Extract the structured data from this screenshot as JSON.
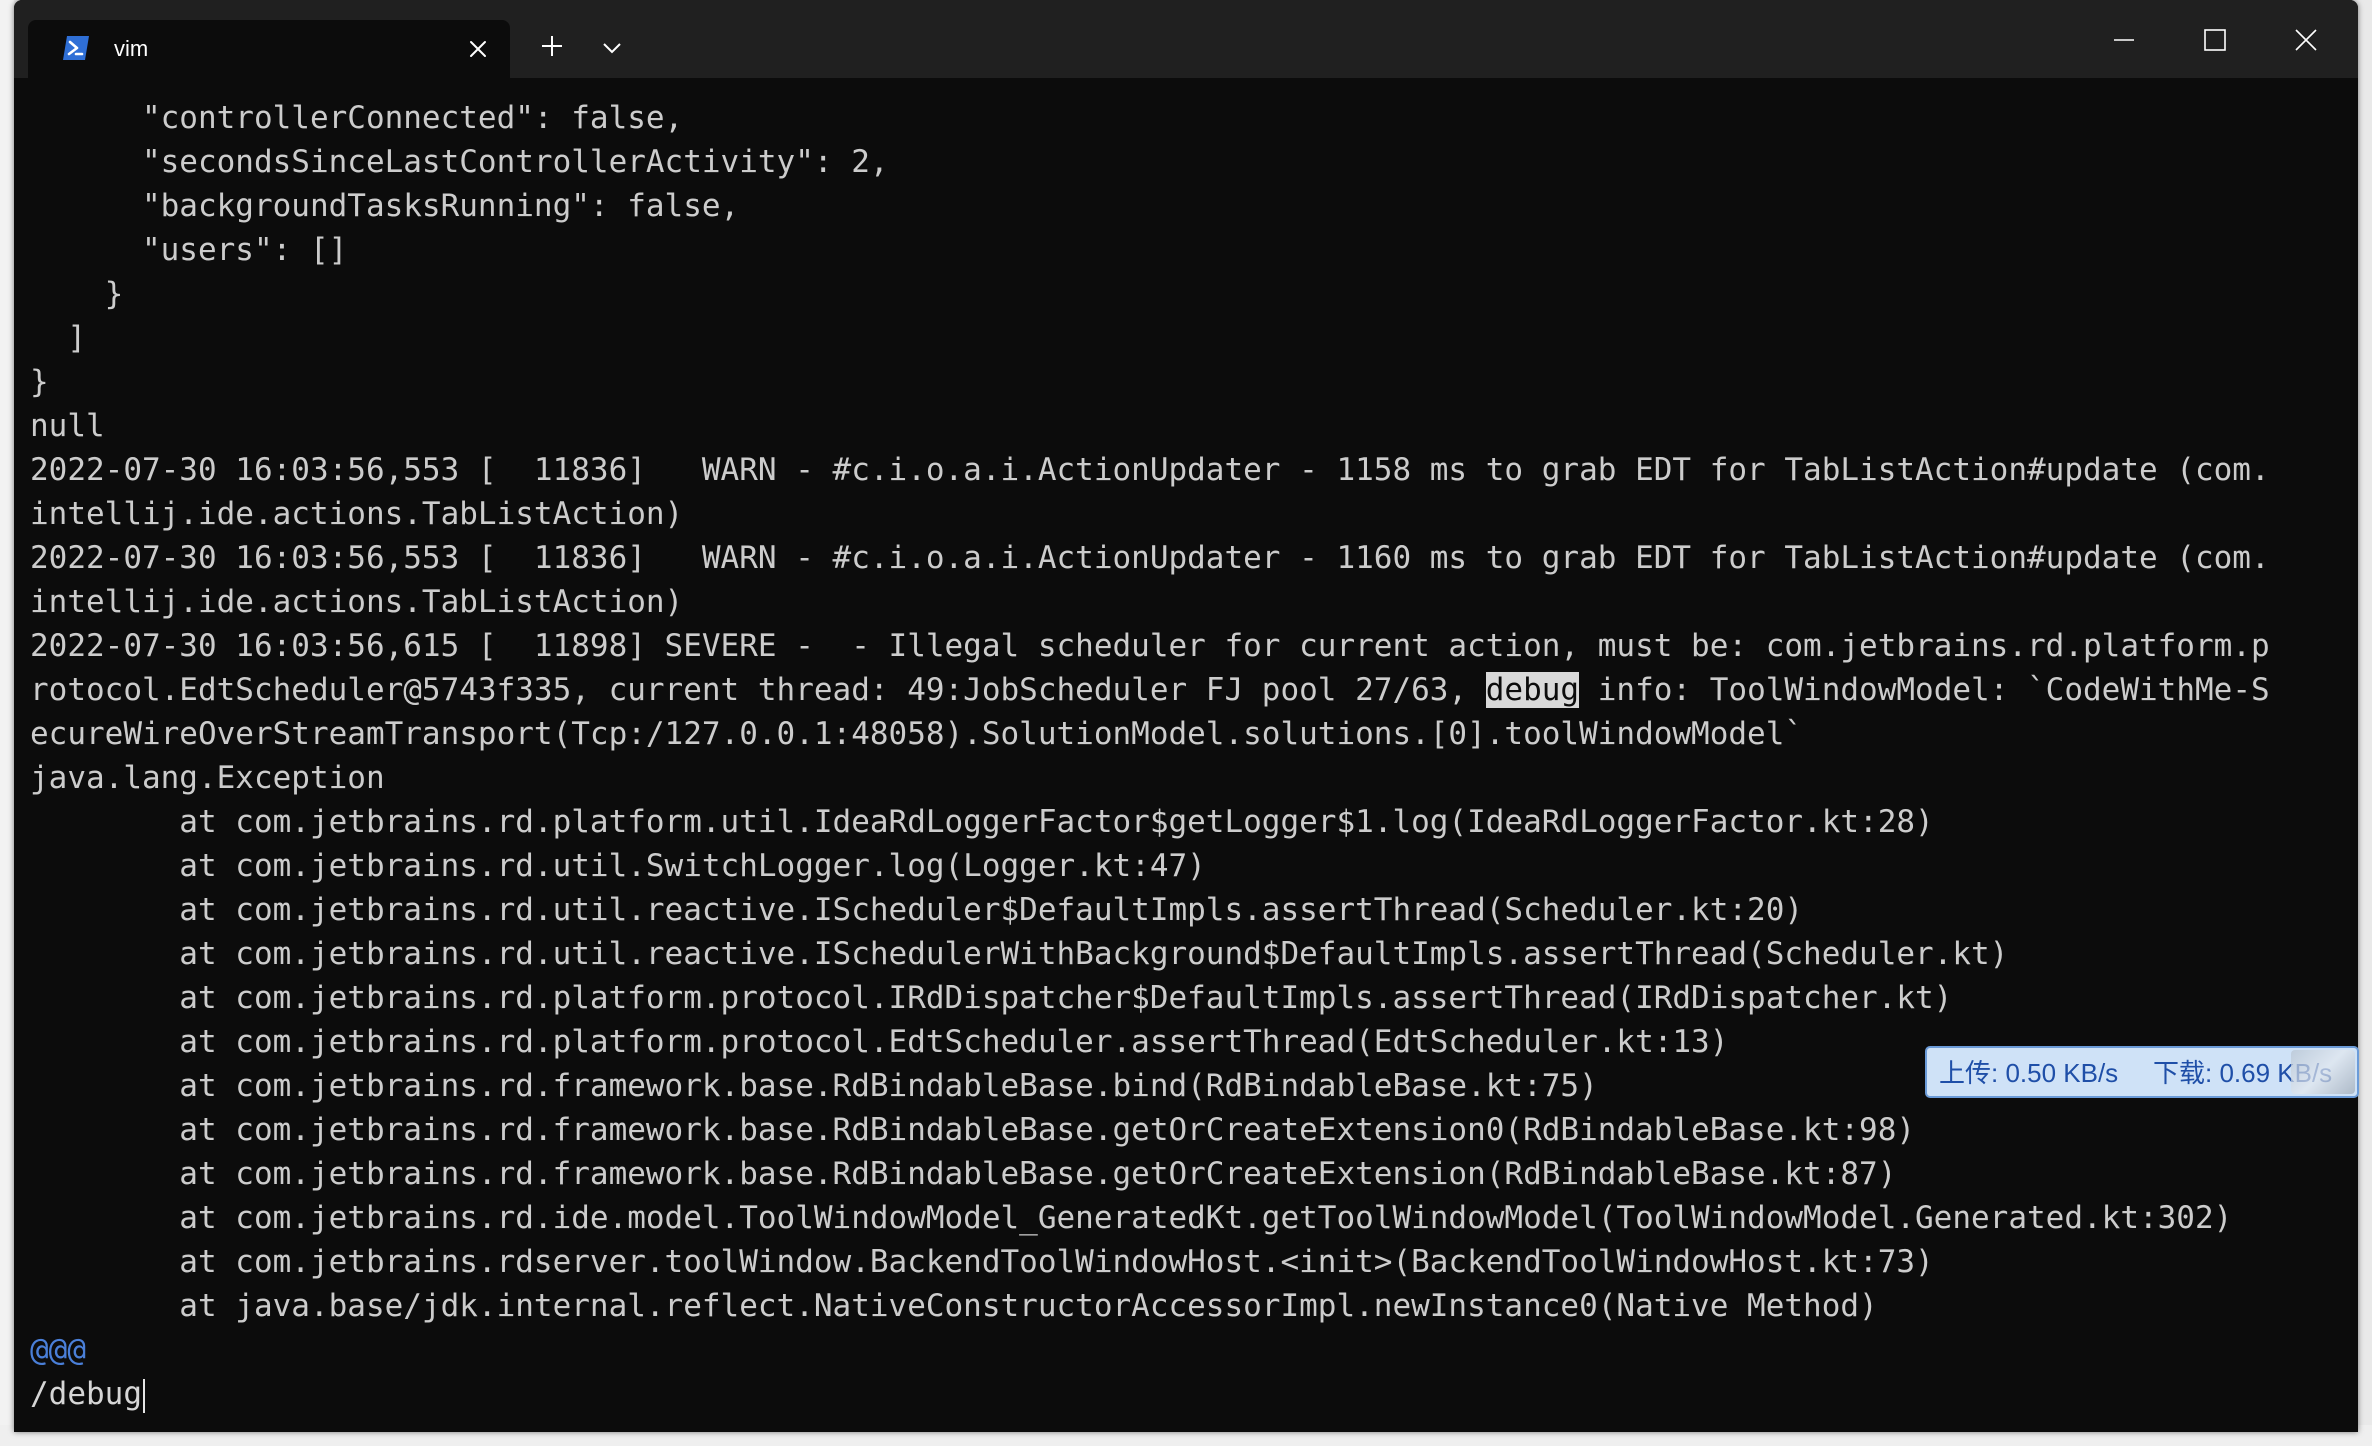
{
  "tab": {
    "title": "vim",
    "icon": "powershell-icon"
  },
  "titlebar": {
    "new_tab_icon": "plus-icon",
    "dropdown_icon": "chevron-down-icon",
    "minimize_icon": "minimize-icon",
    "maximize_icon": "maximize-icon",
    "close_icon": "close-icon"
  },
  "terminal": {
    "lines": [
      "      \"controllerConnected\": false,",
      "      \"secondsSinceLastControllerActivity\": 2,",
      "      \"backgroundTasksRunning\": false,",
      "      \"users\": []",
      "    }",
      "  ]",
      "}",
      "null",
      "2022-07-30 16:03:56,553 [  11836]   WARN - #c.i.o.a.i.ActionUpdater - 1158 ms to grab EDT for TabListAction#update (com.",
      "intellij.ide.actions.TabListAction)",
      "2022-07-30 16:03:56,553 [  11836]   WARN - #c.i.o.a.i.ActionUpdater - 1160 ms to grab EDT for TabListAction#update (com.",
      "intellij.ide.actions.TabListAction)",
      "2022-07-30 16:03:56,615 [  11898] SEVERE -  - Illegal scheduler for current action, must be: com.jetbrains.rd.platform.p"
    ],
    "highlight_line": {
      "before": "rotocol.EdtScheduler@5743f335, current thread: 49:JobScheduler FJ pool 27/63, ",
      "match": "debug",
      "after": " info: ToolWindowModel: `CodeWithMe-S"
    },
    "lines_after": [
      "ecureWireOverStreamTransport(Tcp:/127.0.0.1:48058).SolutionModel.solutions.[0].toolWindowModel`",
      "java.lang.Exception",
      "        at com.jetbrains.rd.platform.util.IdeaRdLoggerFactor$getLogger$1.log(IdeaRdLoggerFactor.kt:28)",
      "        at com.jetbrains.rd.util.SwitchLogger.log(Logger.kt:47)",
      "        at com.jetbrains.rd.util.reactive.IScheduler$DefaultImpls.assertThread(Scheduler.kt:20)",
      "        at com.jetbrains.rd.util.reactive.ISchedulerWithBackground$DefaultImpls.assertThread(Scheduler.kt)",
      "        at com.jetbrains.rd.platform.protocol.IRdDispatcher$DefaultImpls.assertThread(IRdDispatcher.kt)",
      "        at com.jetbrains.rd.platform.protocol.EdtScheduler.assertThread(EdtScheduler.kt:13)",
      "        at com.jetbrains.rd.framework.base.RdBindableBase.bind(RdBindableBase.kt:75)",
      "        at com.jetbrains.rd.framework.base.RdBindableBase.getOrCreateExtension0(RdBindableBase.kt:98)",
      "        at com.jetbrains.rd.framework.base.RdBindableBase.getOrCreateExtension(RdBindableBase.kt:87)",
      "        at com.jetbrains.rd.ide.model.ToolWindowModel_GeneratedKt.getToolWindowModel(ToolWindowModel.Generated.kt:302)",
      "        at com.jetbrains.rdserver.toolWindow.BackendToolWindowHost.<init>(BackendToolWindowHost.kt:73)",
      "        at java.base/jdk.internal.reflect.NativeConstructorAccessorImpl.newInstance0(Native Method)"
    ],
    "vim_marker": "@@@",
    "command_line": "/debug"
  },
  "net_widget": {
    "upload": "上传: 0.50 KB/s",
    "download": "下载: 0.69 KB/s"
  },
  "colors": {
    "terminal_bg": "#0c0c0c",
    "titlebar_bg": "#202020",
    "text": "#cccccc",
    "highlight_bg": "#d9d9d9",
    "vim_marker": "#4a7fd8",
    "net_widget_bg": "#cfe2f7",
    "net_widget_text": "#1f4fa8"
  }
}
